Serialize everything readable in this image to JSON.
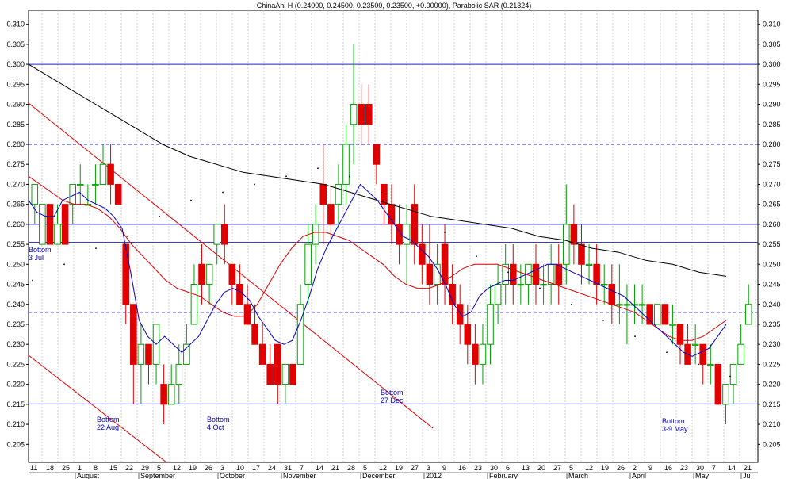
{
  "chart_data": {
    "type": "candlestick",
    "title": "ChinaAni H (0.24000, 0.24500, 0.23500, 0.23500, +0.00000), Parabolic SAR (0.21324)",
    "y_ticks": [
      "0.310",
      "0.305",
      "0.300",
      "0.295",
      "0.290",
      "0.285",
      "0.280",
      "0.275",
      "0.270",
      "0.265",
      "0.260",
      "0.255",
      "0.250",
      "0.245",
      "0.240",
      "0.235",
      "0.230",
      "0.225",
      "0.220",
      "0.215",
      "0.210",
      "0.205"
    ],
    "ylim": [
      0.2005,
      0.3135
    ],
    "x_day_labels": [
      "11",
      "18",
      "25",
      "1",
      "8",
      "15",
      "22",
      "29",
      "5",
      "12",
      "19",
      "26",
      "3",
      "10",
      "17",
      "24",
      "31",
      "7",
      "14",
      "21",
      "28",
      "5",
      "12",
      "19",
      "27",
      "3",
      "9",
      "16",
      "23",
      "30",
      "6",
      "13",
      "20",
      "27",
      "5",
      "12",
      "19",
      "26",
      "2",
      "9",
      "16",
      "23",
      "30",
      "7",
      "14",
      "21"
    ],
    "x_month_labels": [
      "August",
      "September",
      "October",
      "November",
      "December",
      "2012",
      "February",
      "March",
      "April",
      "May",
      "Ju"
    ],
    "horizontal_lines": [
      {
        "y": 0.3,
        "style": "solid"
      },
      {
        "y": 0.28,
        "style": "dashed"
      },
      {
        "y": 0.26,
        "style": "solid"
      },
      {
        "y": 0.2555,
        "style": "solid"
      },
      {
        "y": 0.238,
        "style": "dashed"
      },
      {
        "y": 0.2151,
        "style": "solid"
      }
    ],
    "annotations": [
      {
        "text": "Bottom",
        "text2": "3 Jul"
      },
      {
        "text": "Bottom",
        "text2": "22 Aug"
      },
      {
        "text": "Bottom",
        "text2": "4 Oct"
      },
      {
        "text": "Bottom",
        "text2": "27 Dec"
      },
      {
        "text": "Bottom",
        "text2": "3-9 May"
      }
    ],
    "ohlc": [
      [
        0.265,
        0.27,
        0.26,
        0.27
      ],
      [
        0.255,
        0.265,
        0.255,
        0.265
      ],
      [
        0.265,
        0.265,
        0.255,
        0.255
      ],
      [
        0.255,
        0.265,
        0.255,
        0.26
      ],
      [
        0.265,
        0.265,
        0.255,
        0.255
      ],
      [
        0.265,
        0.27,
        0.26,
        0.27
      ],
      [
        0.27,
        0.275,
        0.265,
        0.27
      ],
      [
        0.265,
        0.27,
        0.265,
        0.265
      ],
      [
        0.27,
        0.275,
        0.265,
        0.27
      ],
      [
        0.27,
        0.28,
        0.27,
        0.275
      ],
      [
        0.275,
        0.28,
        0.265,
        0.27
      ],
      [
        0.27,
        0.27,
        0.265,
        0.265
      ],
      [
        0.255,
        0.255,
        0.235,
        0.24
      ],
      [
        0.24,
        0.24,
        0.215,
        0.225
      ],
      [
        0.225,
        0.235,
        0.215,
        0.23
      ],
      [
        0.23,
        0.23,
        0.22,
        0.225
      ],
      [
        0.225,
        0.235,
        0.22,
        0.235
      ],
      [
        0.22,
        0.225,
        0.21,
        0.215
      ],
      [
        0.215,
        0.225,
        0.215,
        0.22
      ],
      [
        0.22,
        0.23,
        0.215,
        0.225
      ],
      [
        0.225,
        0.235,
        0.225,
        0.23
      ],
      [
        0.235,
        0.25,
        0.235,
        0.245
      ],
      [
        0.25,
        0.255,
        0.24,
        0.245
      ],
      [
        0.245,
        0.25,
        0.24,
        0.25
      ],
      [
        0.255,
        0.26,
        0.25,
        0.26
      ],
      [
        0.26,
        0.265,
        0.25,
        0.255
      ],
      [
        0.25,
        0.25,
        0.24,
        0.245
      ],
      [
        0.245,
        0.25,
        0.24,
        0.24
      ],
      [
        0.24,
        0.245,
        0.235,
        0.235
      ],
      [
        0.235,
        0.24,
        0.23,
        0.23
      ],
      [
        0.23,
        0.235,
        0.225,
        0.225
      ],
      [
        0.225,
        0.23,
        0.22,
        0.22
      ],
      [
        0.23,
        0.23,
        0.215,
        0.22
      ],
      [
        0.22,
        0.225,
        0.215,
        0.225
      ],
      [
        0.225,
        0.225,
        0.22,
        0.22
      ],
      [
        0.225,
        0.245,
        0.225,
        0.24
      ],
      [
        0.245,
        0.26,
        0.24,
        0.255
      ],
      [
        0.255,
        0.265,
        0.25,
        0.26
      ],
      [
        0.27,
        0.28,
        0.255,
        0.265
      ],
      [
        0.265,
        0.27,
        0.255,
        0.26
      ],
      [
        0.265,
        0.275,
        0.26,
        0.27
      ],
      [
        0.27,
        0.285,
        0.265,
        0.28
      ],
      [
        0.285,
        0.305,
        0.275,
        0.29
      ],
      [
        0.29,
        0.295,
        0.28,
        0.285
      ],
      [
        0.29,
        0.295,
        0.28,
        0.285
      ],
      [
        0.28,
        0.28,
        0.27,
        0.275
      ],
      [
        0.27,
        0.27,
        0.26,
        0.265
      ],
      [
        0.265,
        0.27,
        0.255,
        0.26
      ],
      [
        0.26,
        0.265,
        0.25,
        0.255
      ],
      [
        0.255,
        0.265,
        0.245,
        0.26
      ],
      [
        0.265,
        0.27,
        0.25,
        0.255
      ],
      [
        0.255,
        0.26,
        0.245,
        0.25
      ],
      [
        0.25,
        0.26,
        0.24,
        0.245
      ],
      [
        0.245,
        0.255,
        0.24,
        0.25
      ],
      [
        0.255,
        0.26,
        0.24,
        0.245
      ],
      [
        0.245,
        0.25,
        0.235,
        0.24
      ],
      [
        0.24,
        0.245,
        0.23,
        0.235
      ],
      [
        0.235,
        0.24,
        0.225,
        0.23
      ],
      [
        0.23,
        0.235,
        0.22,
        0.225
      ],
      [
        0.225,
        0.235,
        0.22,
        0.23
      ],
      [
        0.23,
        0.245,
        0.225,
        0.24
      ],
      [
        0.24,
        0.25,
        0.235,
        0.245
      ],
      [
        0.245,
        0.255,
        0.24,
        0.25
      ],
      [
        0.25,
        0.255,
        0.24,
        0.245
      ],
      [
        0.245,
        0.25,
        0.24,
        0.245
      ],
      [
        0.245,
        0.25,
        0.24,
        0.25
      ],
      [
        0.25,
        0.255,
        0.24,
        0.245
      ],
      [
        0.245,
        0.25,
        0.24,
        0.245
      ],
      [
        0.245,
        0.255,
        0.24,
        0.25
      ],
      [
        0.25,
        0.255,
        0.24,
        0.245
      ],
      [
        0.25,
        0.27,
        0.245,
        0.26
      ],
      [
        0.26,
        0.265,
        0.25,
        0.255
      ],
      [
        0.255,
        0.26,
        0.245,
        0.25
      ],
      [
        0.25,
        0.255,
        0.245,
        0.25
      ],
      [
        0.25,
        0.255,
        0.24,
        0.245
      ],
      [
        0.245,
        0.25,
        0.24,
        0.245
      ],
      [
        0.245,
        0.25,
        0.235,
        0.24
      ],
      [
        0.24,
        0.25,
        0.235,
        0.24
      ],
      [
        0.24,
        0.245,
        0.23,
        0.24
      ],
      [
        0.24,
        0.245,
        0.235,
        0.24
      ],
      [
        0.24,
        0.245,
        0.235,
        0.24
      ],
      [
        0.24,
        0.24,
        0.235,
        0.235
      ],
      [
        0.235,
        0.24,
        0.235,
        0.24
      ],
      [
        0.24,
        0.24,
        0.235,
        0.235
      ],
      [
        0.235,
        0.24,
        0.23,
        0.235
      ],
      [
        0.235,
        0.235,
        0.225,
        0.23
      ],
      [
        0.23,
        0.235,
        0.225,
        0.225
      ],
      [
        0.23,
        0.235,
        0.225,
        0.23
      ],
      [
        0.23,
        0.23,
        0.22,
        0.225
      ],
      [
        0.225,
        0.23,
        0.22,
        0.225
      ],
      [
        0.225,
        0.225,
        0.215,
        0.215
      ],
      [
        0.215,
        0.22,
        0.21,
        0.22
      ],
      [
        0.22,
        0.225,
        0.215,
        0.225
      ],
      [
        0.225,
        0.235,
        0.225,
        0.23
      ],
      [
        0.235,
        0.245,
        0.235,
        0.24
      ]
    ],
    "ma_short": [
      0.266,
      0.263,
      0.262,
      0.262,
      0.266,
      0.267,
      0.268,
      0.266,
      0.265,
      0.264,
      0.262,
      0.259,
      0.248,
      0.236,
      0.232,
      0.23,
      0.232,
      0.23,
      0.228,
      0.23,
      0.232,
      0.236,
      0.24,
      0.243,
      0.244,
      0.243,
      0.241,
      0.237,
      0.234,
      0.231,
      0.23,
      0.231,
      0.236,
      0.242,
      0.249,
      0.254,
      0.258,
      0.262,
      0.266,
      0.27,
      0.268,
      0.266,
      0.263,
      0.26,
      0.257,
      0.256,
      0.254,
      0.252,
      0.249,
      0.245,
      0.24,
      0.237,
      0.238,
      0.242,
      0.244,
      0.245,
      0.246,
      0.246,
      0.247,
      0.248,
      0.249,
      0.25,
      0.25,
      0.249,
      0.248,
      0.247,
      0.246,
      0.245,
      0.244,
      0.243,
      0.242,
      0.24,
      0.238,
      0.236,
      0.234,
      0.232,
      0.23,
      0.228,
      0.227,
      0.228,
      0.229,
      0.232,
      0.235
    ],
    "ma_mid": [
      0.272,
      0.27,
      0.268,
      0.266,
      0.265,
      0.265,
      0.264,
      0.262,
      0.259,
      0.255,
      0.252,
      0.249,
      0.246,
      0.244,
      0.243,
      0.242,
      0.24,
      0.238,
      0.237,
      0.237,
      0.24,
      0.245,
      0.25,
      0.254,
      0.257,
      0.258,
      0.258,
      0.257,
      0.256,
      0.254,
      0.252,
      0.25,
      0.247,
      0.245,
      0.244,
      0.244,
      0.245,
      0.247,
      0.249,
      0.25,
      0.25,
      0.25,
      0.249,
      0.248,
      0.247,
      0.246,
      0.245,
      0.244,
      0.243,
      0.242,
      0.241,
      0.24,
      0.239,
      0.238,
      0.236,
      0.234,
      0.232,
      0.231,
      0.231,
      0.232,
      0.234,
      0.236
    ],
    "ma_long": [
      0.3,
      0.296,
      0.292,
      0.288,
      0.284,
      0.28,
      0.277,
      0.275,
      0.273,
      0.272,
      0.271,
      0.27,
      0.268,
      0.266,
      0.264,
      0.262,
      0.261,
      0.26,
      0.259,
      0.257,
      0.256,
      0.254,
      0.253,
      0.251,
      0.25,
      0.248,
      0.247
    ],
    "sar": [
      0.246,
      0.25,
      0.254,
      0.257,
      0.262,
      0.266,
      0.268,
      0.27,
      0.272,
      0.274,
      0.272,
      0.268,
      0.264,
      0.258,
      0.252,
      0.248,
      0.244,
      0.24,
      0.236,
      0.232,
      0.228,
      0.225,
      0.222
    ]
  }
}
